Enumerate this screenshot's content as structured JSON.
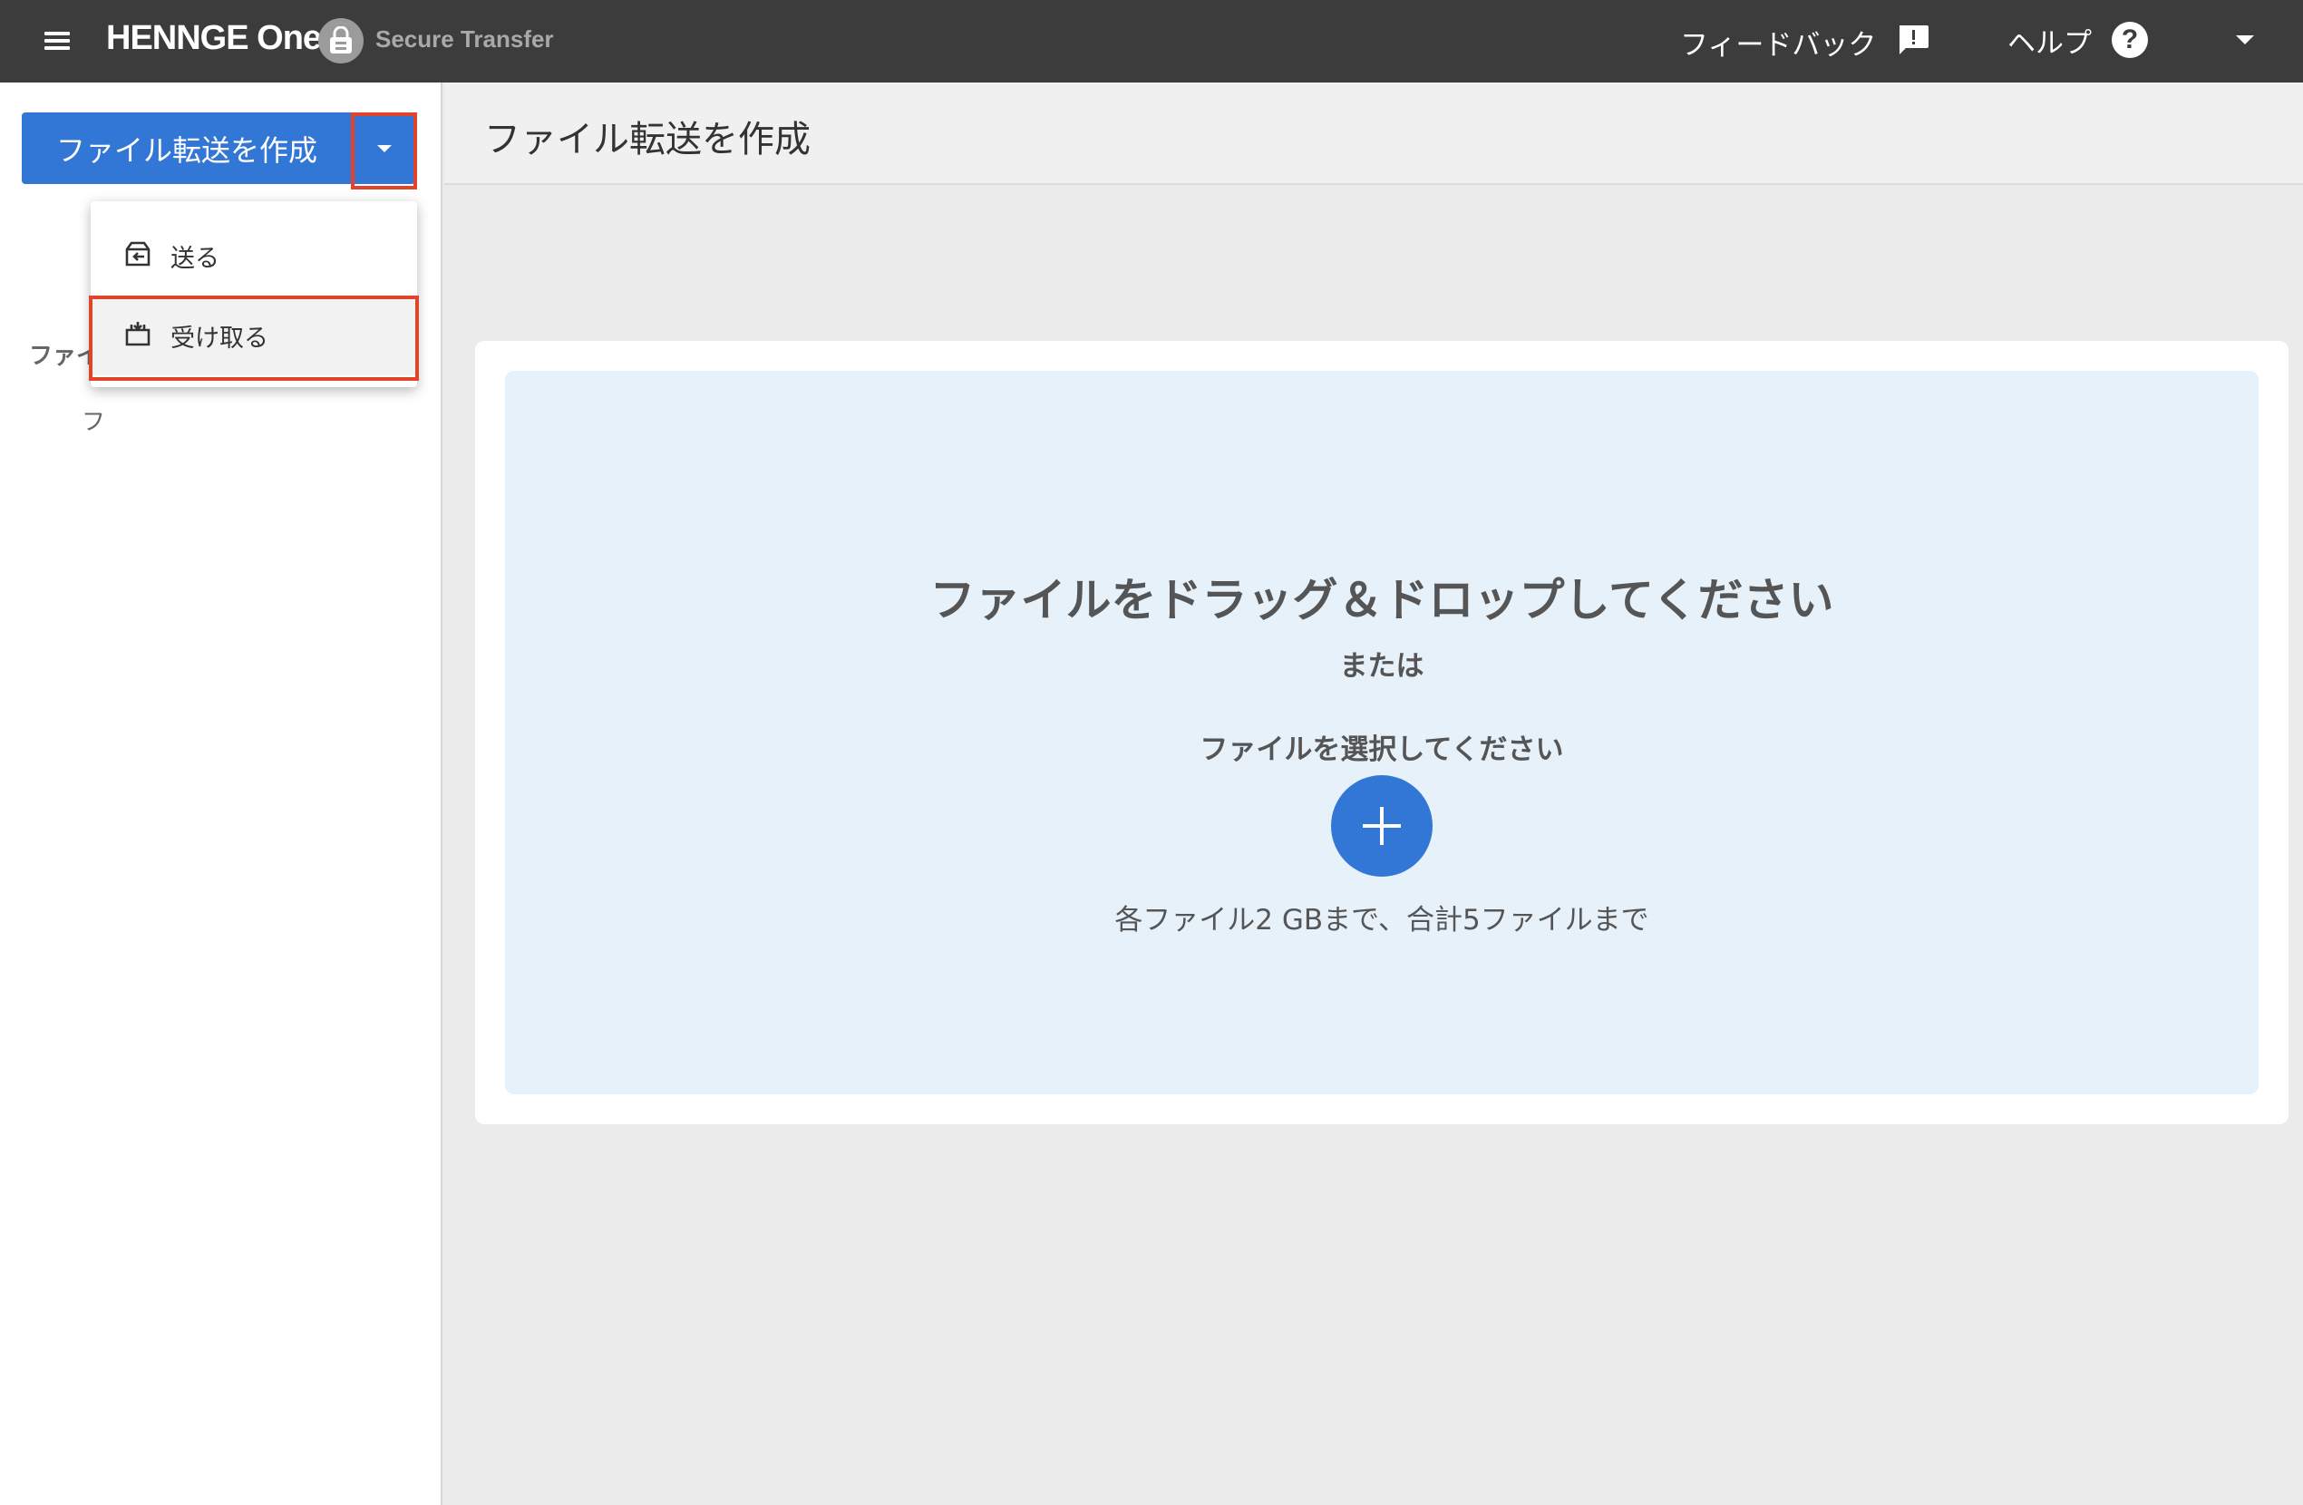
{
  "topbar": {
    "logo_text": "HENNGE One",
    "app_name": "Secure Transfer",
    "feedback_label": "フィードバック",
    "help_label": "ヘルプ",
    "help_icon_glyph": "?"
  },
  "sidebar": {
    "create_button_label": "ファイル転送を作成",
    "section_label": "ファイ",
    "item_label": "フ"
  },
  "dropdown": {
    "items": [
      {
        "label": "送る",
        "icon": "send-box-icon"
      },
      {
        "label": "受け取る",
        "icon": "receive-box-icon"
      }
    ]
  },
  "main": {
    "page_title": "ファイル転送を作成",
    "dropzone": {
      "title": "ファイルをドラッグ＆ドロップしてください",
      "or_text": "または",
      "select_text": "ファイルを選択してください",
      "limit_text": "各ファイル2 GBまで、合計5ファイルまで"
    }
  },
  "colors": {
    "topbar_bg": "#3c3c3c",
    "primary": "#3377d6",
    "highlight": "#e2432b",
    "dropzone_bg": "#e6f1fa"
  }
}
